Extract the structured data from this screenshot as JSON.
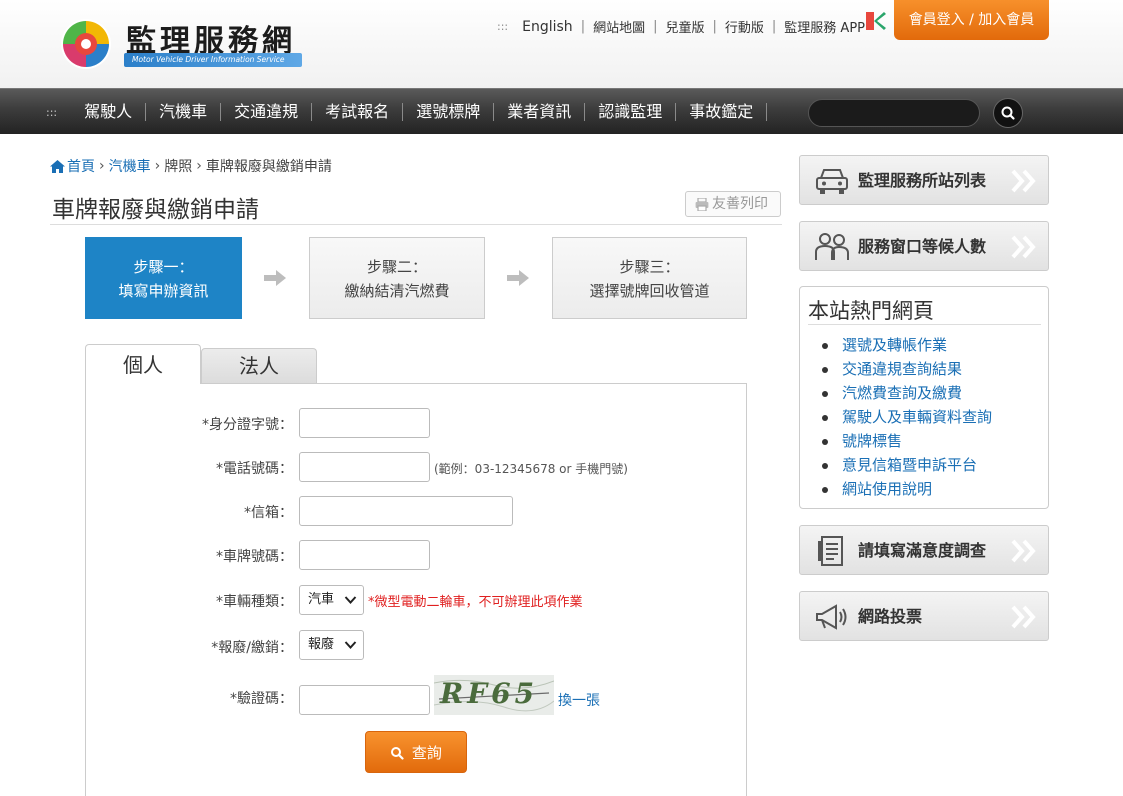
{
  "header": {
    "logo_title": "監理服務網",
    "logo_subtitle": "Motor Vehicle Driver Information Service",
    "top_links": [
      "English",
      "網站地圖",
      "兒童版",
      "行動版",
      "監理服務 APP"
    ],
    "login_label": "會員登入 / 加入會員"
  },
  "nav": {
    "items": [
      "駕駛人",
      "汽機車",
      "交通違規",
      "考試報名",
      "選號標牌",
      "業者資訊",
      "認識監理",
      "事故鑑定"
    ],
    "search_placeholder": ""
  },
  "breadcrumb": [
    "首頁",
    "汽機車",
    "牌照",
    "車牌報廢與繳銷申請"
  ],
  "page_title": "車牌報廢與繳銷申請",
  "print_label": "友善列印",
  "steps": [
    {
      "line1": "步驟一：",
      "line2": "填寫申辦資訊"
    },
    {
      "line1": "步驟二：",
      "line2": "繳納結清汽燃費"
    },
    {
      "line1": "步驟三：",
      "line2": "選擇號牌回收管道"
    }
  ],
  "tabs": [
    "個人",
    "法人"
  ],
  "form": {
    "id_label": "*身分證字號：",
    "phone_label": "*電話號碼：",
    "phone_hint": "(範例：03-12345678 or 手機門號)",
    "email_label": "*信箱：",
    "plate_label": "*車牌號碼：",
    "vehicle_type_label": "*車輛種類：",
    "vehicle_type_value": "汽車",
    "vehicle_warning": "*微型電動二輪車，不可辦理此項作業",
    "action_label": "*報廢/繳銷：",
    "action_value": "報廢",
    "captcha_label": "*驗證碼：",
    "captcha_text": "RF65",
    "refresh_label": "換一張",
    "submit_label": "查詢"
  },
  "sidebar": {
    "btn_offices": "監理服務所站列表",
    "btn_queue": "服務窗口等候人數",
    "hot_title": "本站熱門網頁",
    "hot_links": [
      "選號及轉帳作業",
      "交通違規查詢結果",
      "汽燃費查詢及繳費",
      "駕駛人及車輛資料查詢",
      "號牌標售",
      "意見信箱暨申訴平台",
      "網站使用說明"
    ],
    "btn_survey": "請填寫滿意度調查",
    "btn_vote": "網路投票"
  },
  "colors": {
    "accent_blue": "#1e84c6",
    "link_blue": "#1a6fb5",
    "orange": "#f7902b",
    "warning_red": "#e02020"
  }
}
